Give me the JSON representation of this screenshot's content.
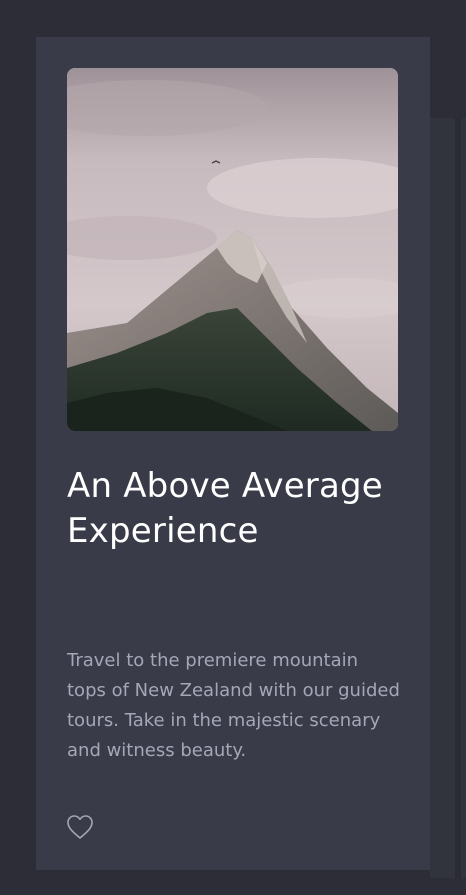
{
  "card": {
    "image_alt": "Mountain peak under a cloudy sky",
    "title": "An Above Average Experience",
    "description": "Travel to the premiere mountain tops of New Zealand with our guided tours. Take in the majestic scenary and witness beauty.",
    "like_icon": "heart-outline-icon"
  },
  "colors": {
    "background": "#2c2d36",
    "card": "#393b48",
    "title": "#ffffff",
    "text": "#a5a6b8",
    "icon": "#a5a6b8"
  }
}
